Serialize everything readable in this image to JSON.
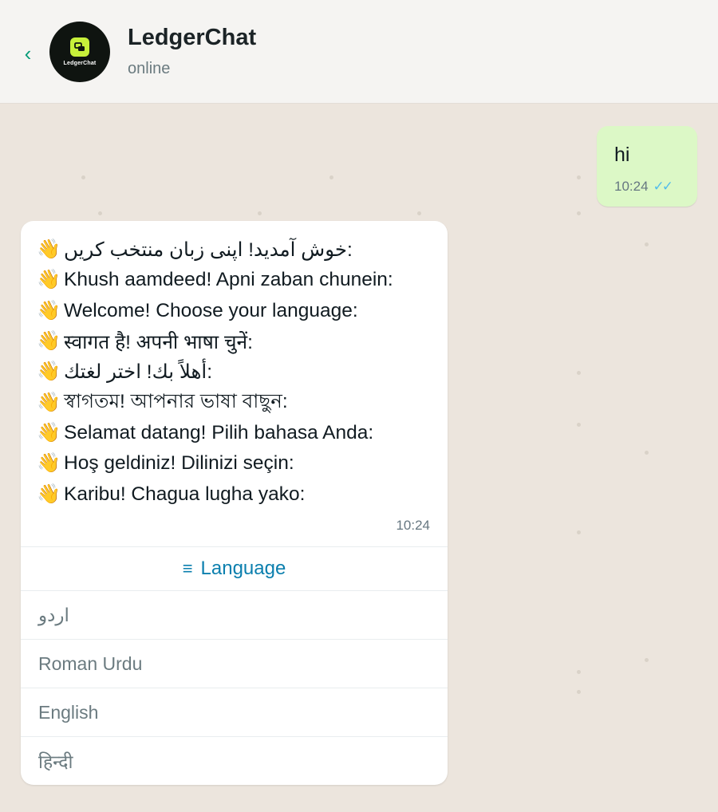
{
  "header": {
    "back_icon": "‹",
    "title": "LedgerChat",
    "status": "online",
    "avatar_text": "LedgerChat",
    "accent": "#c7f03a"
  },
  "messages": {
    "outgoing": {
      "text": "hi",
      "time": "10:24",
      "ticks": "✓✓"
    },
    "incoming": {
      "lines": [
        "خوش آمدید! اپنی زبان منتخب کریں:",
        "Khush aamdeed! Apni zaban chunein:",
        "Welcome! Choose your language:",
        "स्वागत है! अपनी भाषा चुनें:",
        "أهلاً بك! اختر لغتك:",
        "স্বাগতম! আপনার ভাষা বাছুন:",
        "Selamat datang! Pilih bahasa Anda:",
        "Hoş geldiniz! Dilinizi seçin:",
        "Karibu! Chagua lugha yako:"
      ],
      "wave": "👋",
      "time": "10:24",
      "button": {
        "icon": "≡",
        "label": "Language"
      },
      "options": [
        "اردو",
        "Roman Urdu",
        "English",
        "हिन्दी"
      ]
    }
  }
}
